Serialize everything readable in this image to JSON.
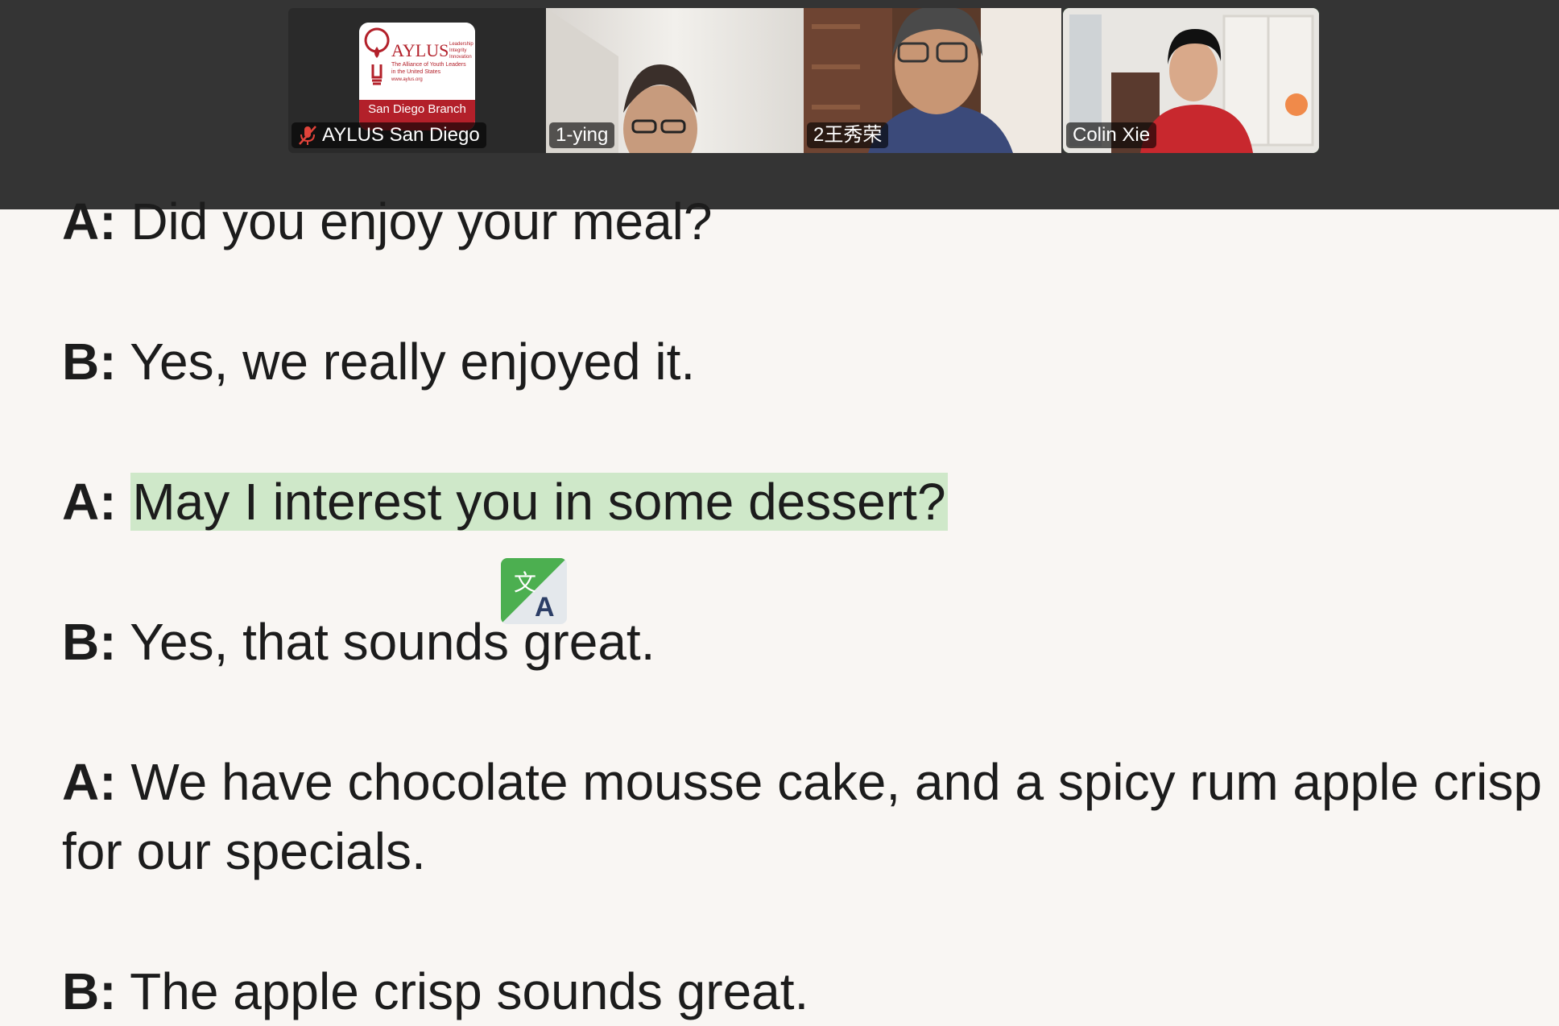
{
  "gallery": {
    "participants": [
      {
        "name": "AYLUS San Diego",
        "muted": true
      },
      {
        "name": "1-ying",
        "muted": false
      },
      {
        "name": "2王秀荣",
        "muted": false
      },
      {
        "name": "Colin Xie",
        "muted": false,
        "active_speaker": true
      }
    ],
    "logo": {
      "title": "AYLUS",
      "tagline_lines": [
        "The Alliance of Youth Leaders",
        "in the United States",
        "www.aylus.org"
      ],
      "side_words": [
        "Leadership",
        "Integrity",
        "Innovation"
      ],
      "branch": "San Diego Branch"
    }
  },
  "dialogue": [
    {
      "speaker": "A:",
      "text": "Did you enjoy your meal?"
    },
    {
      "speaker": "B:",
      "text": "Yes, we really enjoyed it."
    },
    {
      "speaker": "A:",
      "text": "May I interest you in some dessert?",
      "highlighted": true
    },
    {
      "speaker": "B:",
      "text": "Yes, that sounds great."
    },
    {
      "speaker": "A:",
      "text": "We have chocolate mousse cake, and a spicy rum apple crisp"
    },
    {
      "speaker": "",
      "text": "for our specials."
    },
    {
      "speaker": "B:",
      "text": "The apple crisp sounds great."
    }
  ],
  "colors": {
    "gallery_bg": "#343434",
    "doc_bg": "#f9f6f3",
    "highlight": "#cfe8c9",
    "active_border": "#5bd45b",
    "translate_green": "#4caf50"
  },
  "icons": {
    "translate": "translate-icon",
    "muted_mic": "muted-mic-icon"
  }
}
